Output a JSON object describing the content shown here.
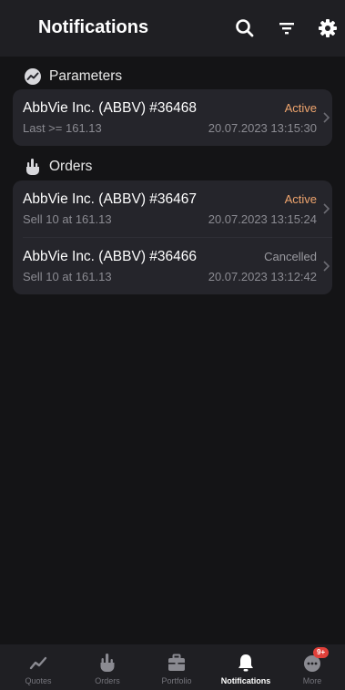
{
  "header": {
    "title": "Notifications",
    "icons": [
      "search-icon",
      "filter-icon",
      "gear-icon"
    ]
  },
  "colors": {
    "status_active": "#f0a56e",
    "status_cancelled": "#9a9aa0",
    "background": "#141416",
    "card": "#25252b"
  },
  "sections": {
    "parameters": {
      "label": "Parameters",
      "icon": "trend-icon",
      "items": [
        {
          "title": "AbbVie Inc. (ABBV) #36468",
          "status": "Active",
          "subtitle": "Last >= 161.13",
          "timestamp": "20.07.2023 13:15:30"
        }
      ]
    },
    "orders": {
      "label": "Orders",
      "icon": "hand-icon",
      "items": [
        {
          "title": "AbbVie Inc. (ABBV) #36467",
          "status": "Active",
          "subtitle": "Sell 10 at  161.13",
          "timestamp": "20.07.2023 13:15:24"
        },
        {
          "title": "AbbVie Inc. (ABBV) #36466",
          "status": "Cancelled",
          "subtitle": "Sell 10 at  161.13",
          "timestamp": "20.07.2023 13:12:42"
        }
      ]
    }
  },
  "nav": {
    "items": [
      {
        "label": "Quotes",
        "icon": "chart-line-icon"
      },
      {
        "label": "Orders",
        "icon": "hand-icon"
      },
      {
        "label": "Portfolio",
        "icon": "briefcase-icon"
      },
      {
        "label": "Notifications",
        "icon": "bell-icon",
        "active": true
      },
      {
        "label": "More",
        "icon": "more-icon",
        "badge": "9+"
      }
    ]
  }
}
